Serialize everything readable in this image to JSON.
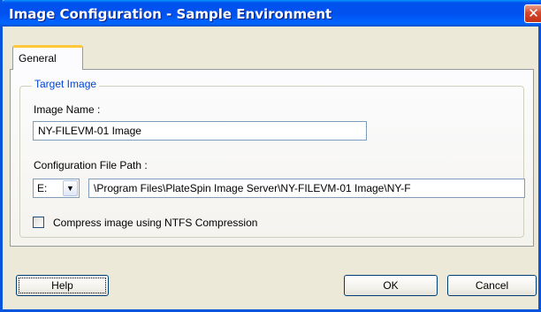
{
  "window": {
    "title": "Image Configuration - Sample Environment",
    "close_symbol": "✕"
  },
  "tabs": [
    {
      "label": "General",
      "selected": true
    }
  ],
  "target_image": {
    "group_label": "Target Image",
    "image_name_label": "Image Name :",
    "image_name_value": "NY-FILEVM-01 Image",
    "config_path_label": "Configuration File Path :",
    "drive_value": "E:",
    "path_value": "\\Program Files\\PlateSpin Image Server\\NY-FILEVM-01 Image\\NY-F",
    "compress_label": "Compress image using NTFS Compression",
    "compress_checked": false
  },
  "buttons": {
    "help": "Help",
    "ok": "OK",
    "cancel": "Cancel"
  },
  "colors": {
    "title_bar": "#0055e5",
    "group_label": "#0046d5",
    "dialog_bg": "#ece9d8"
  }
}
